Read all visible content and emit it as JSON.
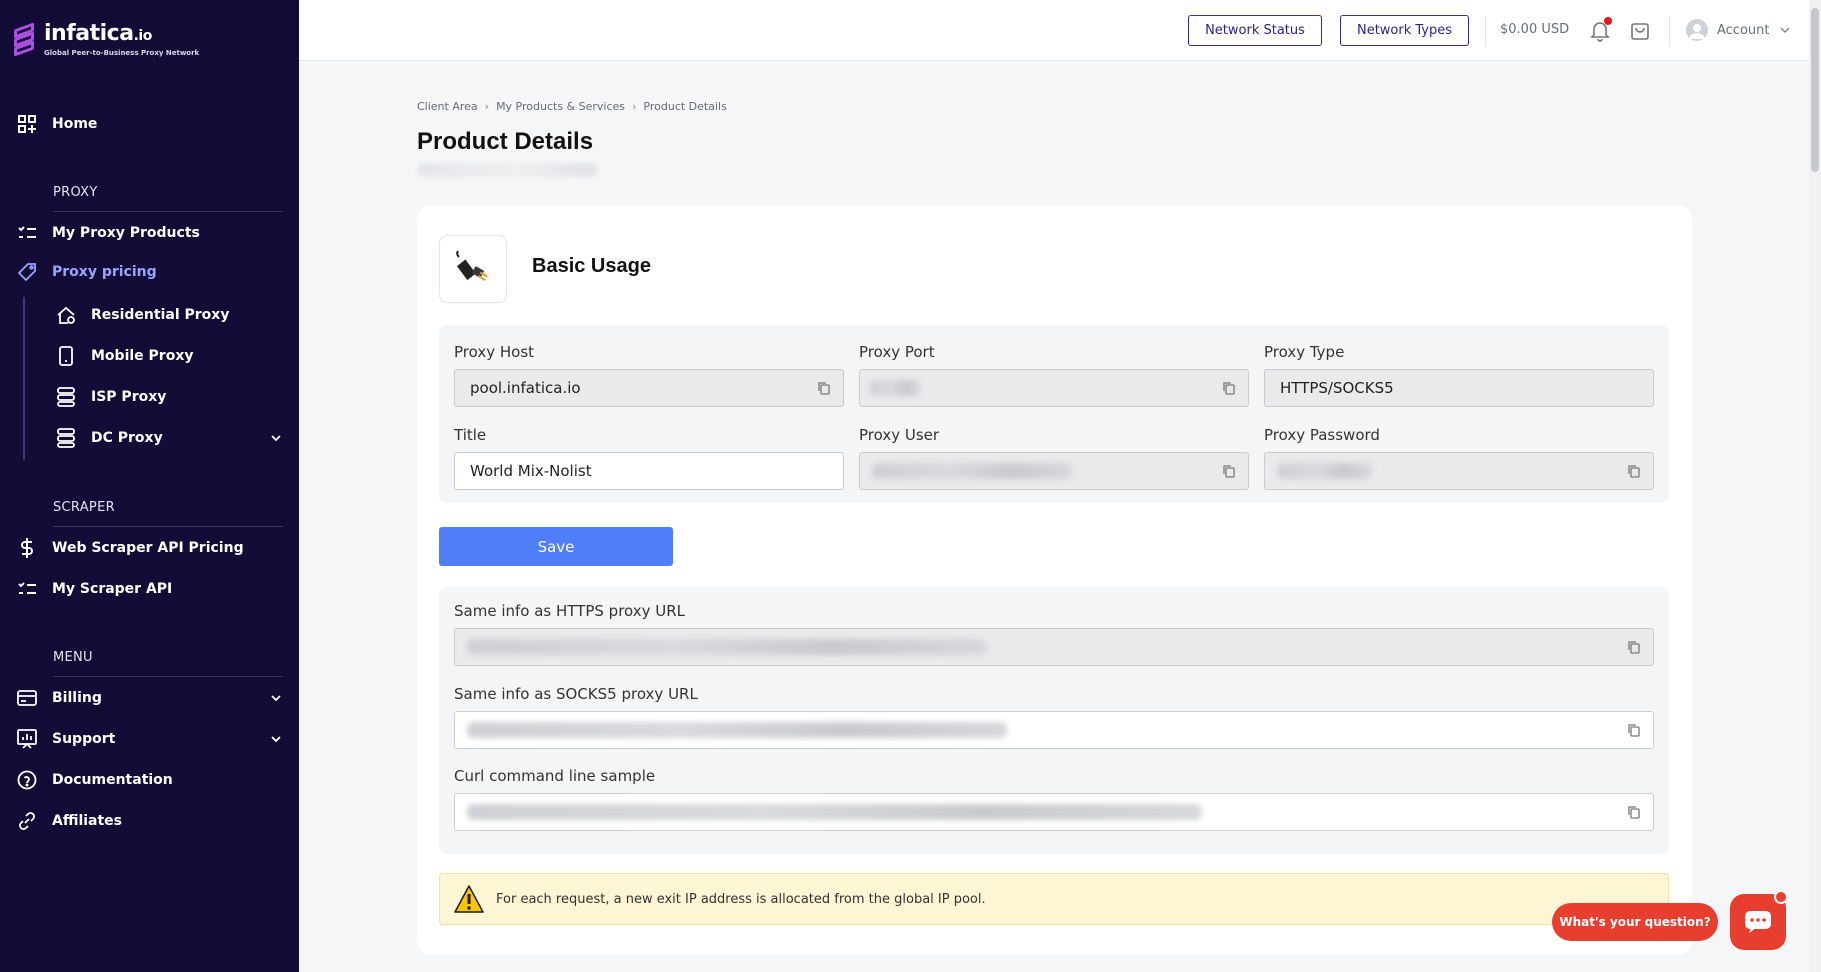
{
  "brand": {
    "name": "infatica",
    "tld": ".io",
    "tagline": "Global Peer-to-Business Proxy Network",
    "accent": "#b04ee6"
  },
  "sidebar": {
    "home": "Home",
    "section_proxy": "PROXY",
    "my_proxy_products": "My Proxy Products",
    "proxy_pricing": "Proxy pricing",
    "residential": "Residential Proxy",
    "mobile": "Mobile Proxy",
    "isp": "ISP Proxy",
    "dc": "DC Proxy",
    "section_scraper": "SCRAPER",
    "web_scraper_pricing": "Web Scraper API Pricing",
    "my_scraper_api": "My Scraper API",
    "section_menu": "MENU",
    "billing": "Billing",
    "support": "Support",
    "documentation": "Documentation",
    "affiliates": "Affiliates"
  },
  "topbar": {
    "network_status": "Network Status",
    "network_types": "Network Types",
    "balance": "$0.00 USD",
    "account": "Account"
  },
  "breadcrumb": {
    "items": [
      "Client Area",
      "My Products & Services",
      "Product Details"
    ]
  },
  "page": {
    "title": "Product Details"
  },
  "card": {
    "title": "Basic Usage",
    "fields": {
      "proxy_host_label": "Proxy Host",
      "proxy_host_value": "pool.infatica.io",
      "proxy_port_label": "Proxy Port",
      "proxy_type_label": "Proxy Type",
      "proxy_type_value": "HTTPS/SOCKS5",
      "title_label": "Title",
      "title_value": "World Mix-Nolist",
      "proxy_user_label": "Proxy User",
      "proxy_password_label": "Proxy Password"
    },
    "save": "Save",
    "urls": {
      "https_label": "Same info as HTTPS proxy URL",
      "socks5_label": "Same info as SOCKS5 proxy URL",
      "curl_label": "Curl command line sample"
    },
    "alert": "For each request, a new exit IP address is allocated from the global IP pool."
  },
  "chat": {
    "prompt": "What's your question?"
  }
}
